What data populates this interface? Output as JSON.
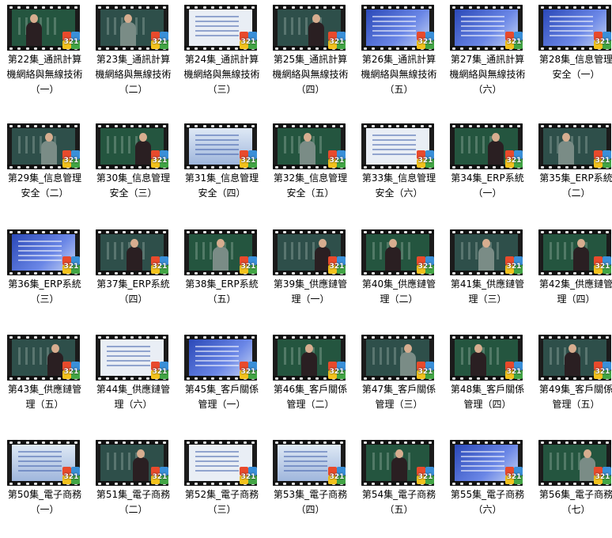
{
  "items": [
    {
      "label": "第22集_通訊計算機網絡與無線技術（一）",
      "thumb": "board-person"
    },
    {
      "label": "第23集_通訊計算機網絡與無線技術（二）",
      "thumb": "board-person"
    },
    {
      "label": "第24集_通訊計算機網絡與無線技術（三）",
      "thumb": "slide-white"
    },
    {
      "label": "第25集_通訊計算機網絡與無線技術（四）",
      "thumb": "board-person"
    },
    {
      "label": "第26集_通訊計算機網絡與無線技術（五）",
      "thumb": "slide-blue"
    },
    {
      "label": "第27集_通訊計算機網絡與無線技術（六）",
      "thumb": "slide-blue"
    },
    {
      "label": "第28集_信息管理安全（一）",
      "thumb": "slide-blue"
    },
    {
      "label": "第29集_信息管理安全（二）",
      "thumb": "board-person"
    },
    {
      "label": "第30集_信息管理安全（三）",
      "thumb": "board-person"
    },
    {
      "label": "第31集_信息管理安全（四）",
      "thumb": "slide-lt"
    },
    {
      "label": "第32集_信息管理安全（五）",
      "thumb": "board-person"
    },
    {
      "label": "第33集_信息管理安全（六）",
      "thumb": "slide-white"
    },
    {
      "label": "第34集_ERP系統（一）",
      "thumb": "board-person"
    },
    {
      "label": "第35集_ERP系統（二）",
      "thumb": "board-person"
    },
    {
      "label": "第36集_ERP系統（三）",
      "thumb": "slide-blue"
    },
    {
      "label": "第37集_ERP系統（四）",
      "thumb": "board-person"
    },
    {
      "label": "第38集_ERP系統（五）",
      "thumb": "board-chalk"
    },
    {
      "label": "第39集_供應鏈管理（一）",
      "thumb": "board-person"
    },
    {
      "label": "第40集_供應鏈管理（二）",
      "thumb": "board-person"
    },
    {
      "label": "第41集_供應鏈管理（三）",
      "thumb": "board-chalk"
    },
    {
      "label": "第42集_供應鏈管理（四）",
      "thumb": "board-person"
    },
    {
      "label": "第43集_供應鏈管理（五）",
      "thumb": "board-person"
    },
    {
      "label": "第44集_供應鏈管理（六）",
      "thumb": "slide-white"
    },
    {
      "label": "第45集_客戶關係管理（一）",
      "thumb": "slide-blue"
    },
    {
      "label": "第46集_客戶關係管理（二）",
      "thumb": "board-chalk"
    },
    {
      "label": "第47集_客戶關係管理（三）",
      "thumb": "board-person"
    },
    {
      "label": "第48集_客戶關係管理（四）",
      "thumb": "board-person"
    },
    {
      "label": "第49集_客戶關係管理（五）",
      "thumb": "board-person"
    },
    {
      "label": "第50集_電子商務（一）",
      "thumb": "slide-lt"
    },
    {
      "label": "第51集_電子商務（二）",
      "thumb": "board-person"
    },
    {
      "label": "第52集_電子商務（三）",
      "thumb": "slide-white"
    },
    {
      "label": "第53集_電子商務（四）",
      "thumb": "slide-lt"
    },
    {
      "label": "第54集_電子商務（五）",
      "thumb": "board-person"
    },
    {
      "label": "第55集_電子商務（六）",
      "thumb": "slide-blue"
    },
    {
      "label": "第56集_電子商務（七）",
      "thumb": "board-person"
    }
  ]
}
